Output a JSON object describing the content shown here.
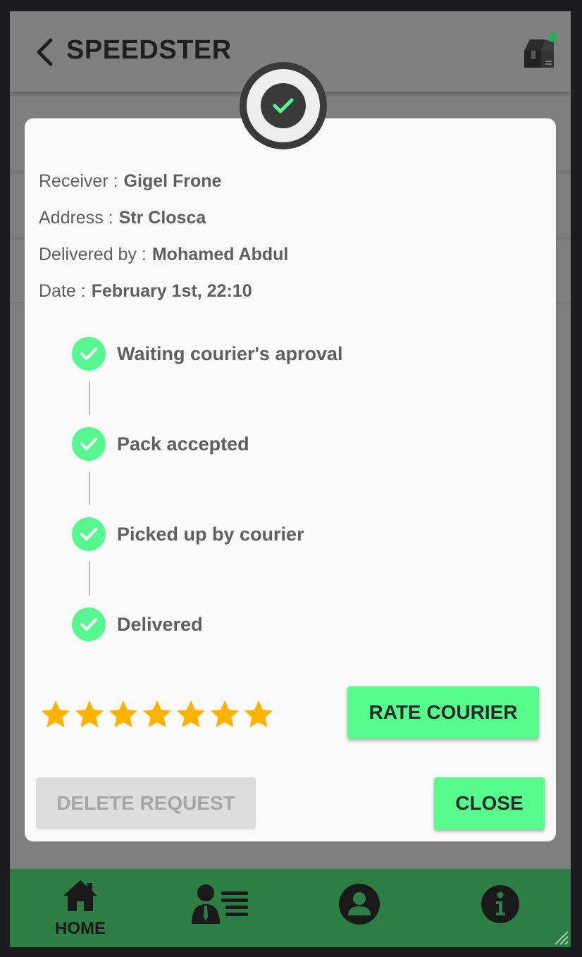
{
  "header": {
    "title": "SPEEDSTER",
    "back_icon": "chevron-left-icon",
    "package_icon": "package-box-icon",
    "notification_color": "#2fa85a"
  },
  "modal": {
    "status_icon": "check-circle-icon",
    "info": [
      {
        "label": "Receiver :",
        "value": "Gigel Frone"
      },
      {
        "label": "Address :",
        "value": "Str Closca"
      },
      {
        "label": "Delivered by :",
        "value": "Mohamed Abdul"
      },
      {
        "label": "Date :",
        "value": "February 1st, 22:10"
      }
    ],
    "steps": [
      {
        "label": "Waiting courier's aproval",
        "done": true
      },
      {
        "label": "Pack accepted",
        "done": true
      },
      {
        "label": "Picked up by courier",
        "done": true
      },
      {
        "label": "Delivered",
        "done": true
      }
    ],
    "rating": {
      "stars": 7,
      "color": "#ffb300"
    },
    "rate_button": "RATE COURIER",
    "delete_button": "DELETE REQUEST",
    "close_button": "CLOSE"
  },
  "nav": {
    "items": [
      {
        "label": "HOME",
        "icon": "home-icon"
      },
      {
        "label": "",
        "icon": "courier-list-icon"
      },
      {
        "label": "",
        "icon": "account-icon"
      },
      {
        "label": "",
        "icon": "info-icon"
      }
    ]
  },
  "colors": {
    "accent": "#56fa8d",
    "nav_background": "#2e7d45",
    "text": "#5f5f5f"
  }
}
